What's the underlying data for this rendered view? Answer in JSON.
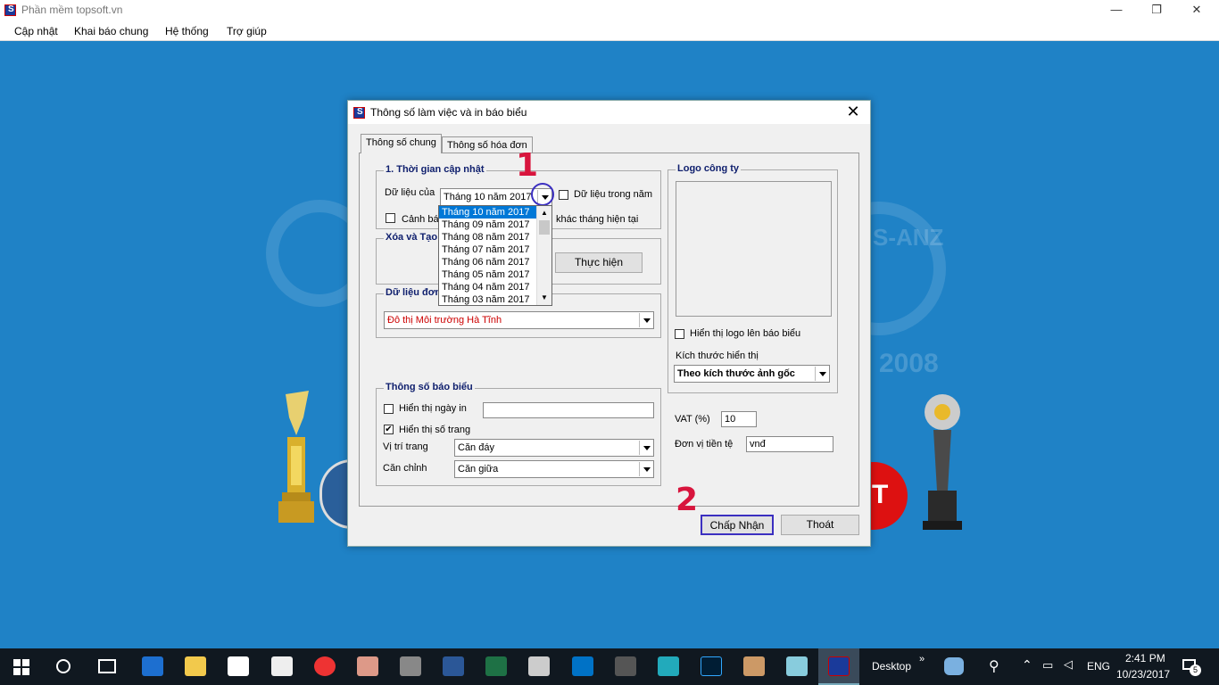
{
  "window": {
    "title": "Phần mềm topsoft.vn",
    "minimize": "—",
    "restore": "❐",
    "close": "✕"
  },
  "menu": [
    "Cập nhật",
    "Khai báo chung",
    "Hệ thống",
    "Trợ giúp"
  ],
  "background": {
    "watermark_text": "S-ANZ",
    "year_text": "2008",
    "badge_text": "T"
  },
  "dialog": {
    "title": "Thông số làm việc và in báo biểu",
    "close": "✕",
    "tabs": [
      "Thông số chung",
      "Thông số hóa đơn"
    ],
    "group_update_time": {
      "title": "1. Thời gian cập nhật",
      "data_of_label": "Dữ liệu của",
      "data_of_value": "Tháng 10 năm 2017",
      "data_in_year_label": "Dữ liệu trong năm",
      "warn_label_left": "Cảnh bá",
      "warn_label_right": "khác tháng hiện tại"
    },
    "group_delete": {
      "title": "Xóa và Tạo",
      "execute_button": "Thực hiện"
    },
    "group_unit": {
      "title": "Dữ liệu đơn",
      "unit_value": "Đô thị Môi trường Hà Tĩnh"
    },
    "group_report": {
      "title": "Thông số báo biểu",
      "show_print_date_label": "Hiển thị ngày in",
      "show_page_number_label": "Hiển thị số trang",
      "page_number_checked": "✔",
      "page_position_label": "Vị trí trang",
      "page_position_value": "Căn đáy",
      "align_label": "Căn chỉnh",
      "align_value": "Căn giữa"
    },
    "group_logo": {
      "title": "Logo công ty",
      "show_logo_label": "Hiển thị logo lên báo biểu",
      "size_label": "Kích thước hiển thị",
      "size_value": "Theo kích thước ảnh gốc"
    },
    "vat_label": "VAT (%)",
    "vat_value": "10",
    "currency_label": "Đơn vị tiền tệ",
    "currency_value": "vnđ",
    "accept_button": "Chấp Nhận",
    "exit_button": "Thoát",
    "month_dropdown": [
      "Tháng 10 năm 2017",
      "Tháng 09 năm 2017",
      "Tháng 08 năm 2017",
      "Tháng 07 năm 2017",
      "Tháng 06 năm 2017",
      "Tháng 05 năm 2017",
      "Tháng 04 năm 2017",
      "Tháng 03 năm 2017"
    ]
  },
  "annotations": [
    "1",
    "2"
  ],
  "taskbar": {
    "desktop_label": "Desktop",
    "chevron": "»",
    "language": "ENG",
    "time": "2:41 PM",
    "date": "10/23/2017",
    "notification_count": "5"
  }
}
